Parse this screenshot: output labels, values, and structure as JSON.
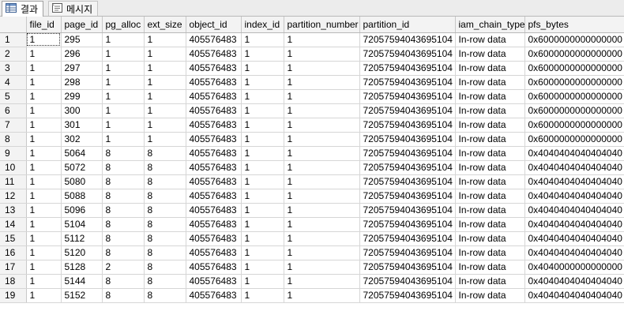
{
  "tabs": [
    {
      "label": "결과",
      "icon": "grid-icon",
      "active": true
    },
    {
      "label": "메시지",
      "icon": "message-icon",
      "active": false
    }
  ],
  "columns": [
    "file_id",
    "page_id",
    "pg_alloc",
    "ext_size",
    "object_id",
    "index_id",
    "partition_number",
    "partition_id",
    "iam_chain_type",
    "pfs_bytes"
  ],
  "rows": [
    [
      "1",
      "1",
      "295",
      "1",
      "1",
      "405576483",
      "1",
      "1",
      "72057594043695104",
      "In-row data",
      "0x6000000000000000"
    ],
    [
      "2",
      "1",
      "296",
      "1",
      "1",
      "405576483",
      "1",
      "1",
      "72057594043695104",
      "In-row data",
      "0x6000000000000000"
    ],
    [
      "3",
      "1",
      "297",
      "1",
      "1",
      "405576483",
      "1",
      "1",
      "72057594043695104",
      "In-row data",
      "0x6000000000000000"
    ],
    [
      "4",
      "1",
      "298",
      "1",
      "1",
      "405576483",
      "1",
      "1",
      "72057594043695104",
      "In-row data",
      "0x6000000000000000"
    ],
    [
      "5",
      "1",
      "299",
      "1",
      "1",
      "405576483",
      "1",
      "1",
      "72057594043695104",
      "In-row data",
      "0x6000000000000000"
    ],
    [
      "6",
      "1",
      "300",
      "1",
      "1",
      "405576483",
      "1",
      "1",
      "72057594043695104",
      "In-row data",
      "0x6000000000000000"
    ],
    [
      "7",
      "1",
      "301",
      "1",
      "1",
      "405576483",
      "1",
      "1",
      "72057594043695104",
      "In-row data",
      "0x6000000000000000"
    ],
    [
      "8",
      "1",
      "302",
      "1",
      "1",
      "405576483",
      "1",
      "1",
      "72057594043695104",
      "In-row data",
      "0x6000000000000000"
    ],
    [
      "9",
      "1",
      "5064",
      "8",
      "8",
      "405576483",
      "1",
      "1",
      "72057594043695104",
      "In-row data",
      "0x4040404040404040"
    ],
    [
      "10",
      "1",
      "5072",
      "8",
      "8",
      "405576483",
      "1",
      "1",
      "72057594043695104",
      "In-row data",
      "0x4040404040404040"
    ],
    [
      "11",
      "1",
      "5080",
      "8",
      "8",
      "405576483",
      "1",
      "1",
      "72057594043695104",
      "In-row data",
      "0x4040404040404040"
    ],
    [
      "12",
      "1",
      "5088",
      "8",
      "8",
      "405576483",
      "1",
      "1",
      "72057594043695104",
      "In-row data",
      "0x4040404040404040"
    ],
    [
      "13",
      "1",
      "5096",
      "8",
      "8",
      "405576483",
      "1",
      "1",
      "72057594043695104",
      "In-row data",
      "0x4040404040404040"
    ],
    [
      "14",
      "1",
      "5104",
      "8",
      "8",
      "405576483",
      "1",
      "1",
      "72057594043695104",
      "In-row data",
      "0x4040404040404040"
    ],
    [
      "15",
      "1",
      "5112",
      "8",
      "8",
      "405576483",
      "1",
      "1",
      "72057594043695104",
      "In-row data",
      "0x4040404040404040"
    ],
    [
      "16",
      "1",
      "5120",
      "8",
      "8",
      "405576483",
      "1",
      "1",
      "72057594043695104",
      "In-row data",
      "0x4040404040404040"
    ],
    [
      "17",
      "1",
      "5128",
      "2",
      "8",
      "405576483",
      "1",
      "1",
      "72057594043695104",
      "In-row data",
      "0x4040000000000000"
    ],
    [
      "18",
      "1",
      "5144",
      "8",
      "8",
      "405576483",
      "1",
      "1",
      "72057594043695104",
      "In-row data",
      "0x4040404040404040"
    ],
    [
      "19",
      "1",
      "5152",
      "8",
      "8",
      "405576483",
      "1",
      "1",
      "72057594043695104",
      "In-row data",
      "0x4040404040404040"
    ]
  ],
  "colors": {
    "header_bg": "#f3f3f3",
    "gridline": "#d6d6d6",
    "tabbar_bg": "#ececec"
  }
}
